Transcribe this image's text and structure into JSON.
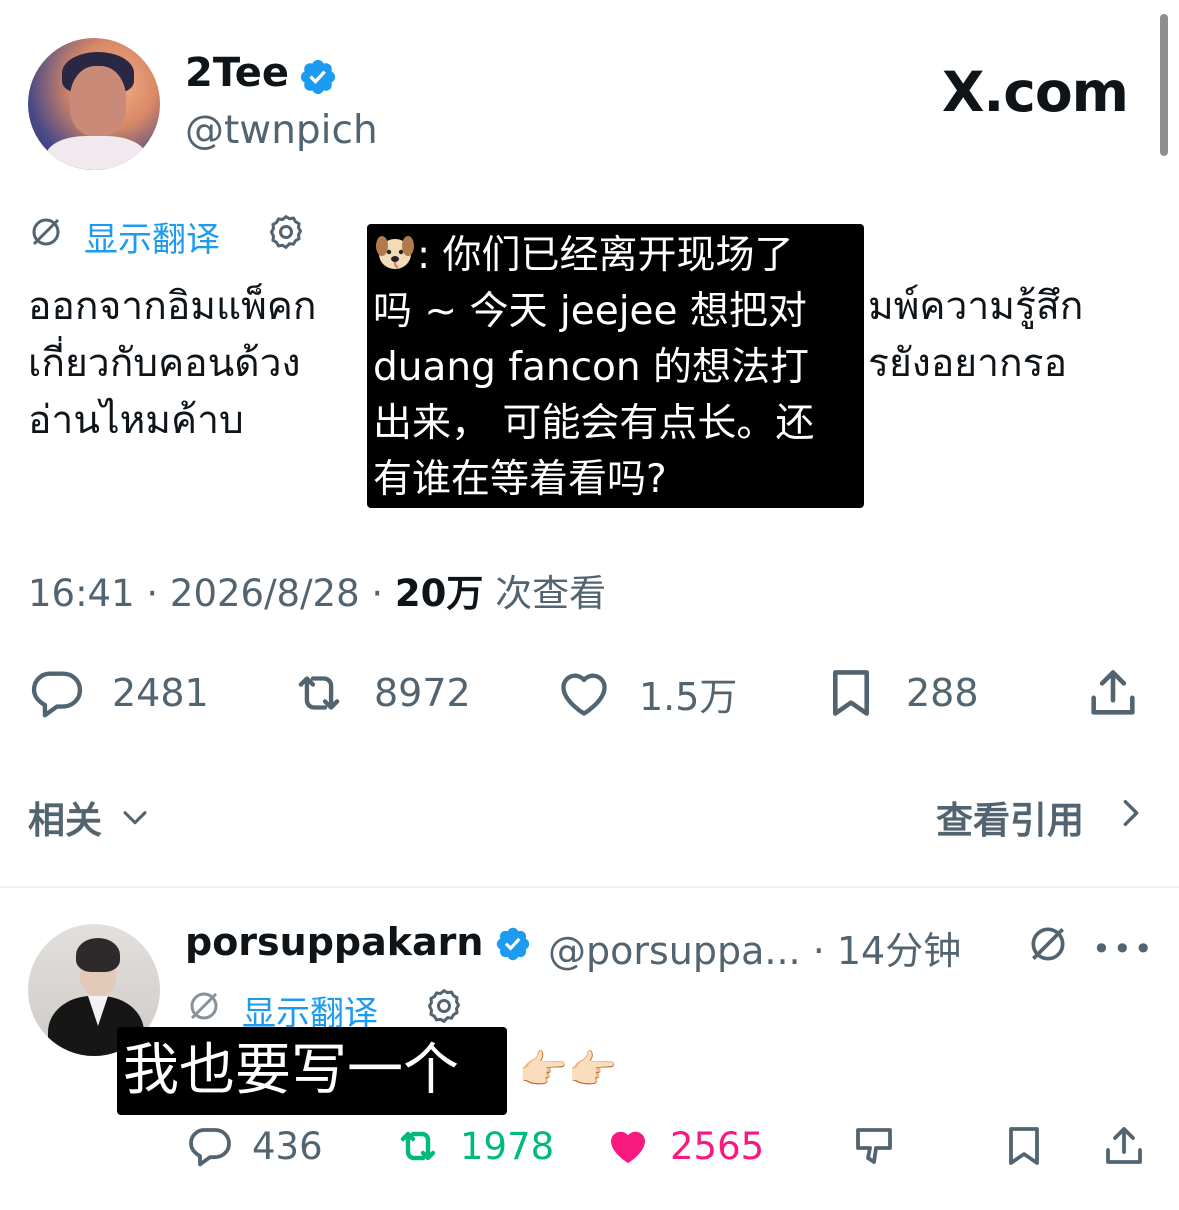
{
  "tweet": {
    "author_name": "2Tee",
    "author_handle": "@twnpich",
    "site_logo": "X.com",
    "translate_label": "显示翻译",
    "text": "ออกจากอิมแพ็คก มพ์ความรู้สึก เกี่ยวกับคอนด้วง รยังอยากรอ อ่านไหมค้าบ",
    "text_lines": [
      "ออกจากอิมแพ็คก",
      "มพ์ความรู้สึก",
      "เกี่ยวกับคอนด้วง",
      "รยังอยากรอ",
      "อ่านไหมค้าบ"
    ],
    "overlay_lines": [
      ": 你们已经离开现场了",
      "吗 ~ 今天 jeejee 想把对",
      "duang fancon 的想法打",
      "出来， 可能会有点长。还",
      "有谁在等着看吗?"
    ],
    "time": "16:41 · 2026/8/28 · ",
    "views_count": "20万",
    "views_label": " 次查看",
    "actions": {
      "replies": "2481",
      "retweets": "8972",
      "likes": "1.5万",
      "bookmarks": "288"
    },
    "related_label": "相关",
    "quotes_label": "查看引用"
  },
  "reply": {
    "author_name": "porsuppakarn",
    "author_handle": "@porsuppa... · 14分钟",
    "translate_label": "显示翻译",
    "overlay_text": "我也要写一个",
    "emoji": "👉🏻👉🏻",
    "actions": {
      "replies": "436",
      "retweets": "1978",
      "likes": "2565"
    }
  },
  "colors": {
    "accent": "#1d9bf0",
    "muted": "#536471",
    "retweet_active": "#00ba7c",
    "like_active": "#f91880"
  },
  "icons": [
    "verified-badge-icon",
    "no-translate-icon",
    "gear-icon",
    "reply-icon",
    "retweet-icon",
    "like-icon",
    "bookmark-icon",
    "share-icon",
    "chevron-down-icon",
    "chevron-right-icon",
    "more-icon",
    "grok-icon"
  ]
}
